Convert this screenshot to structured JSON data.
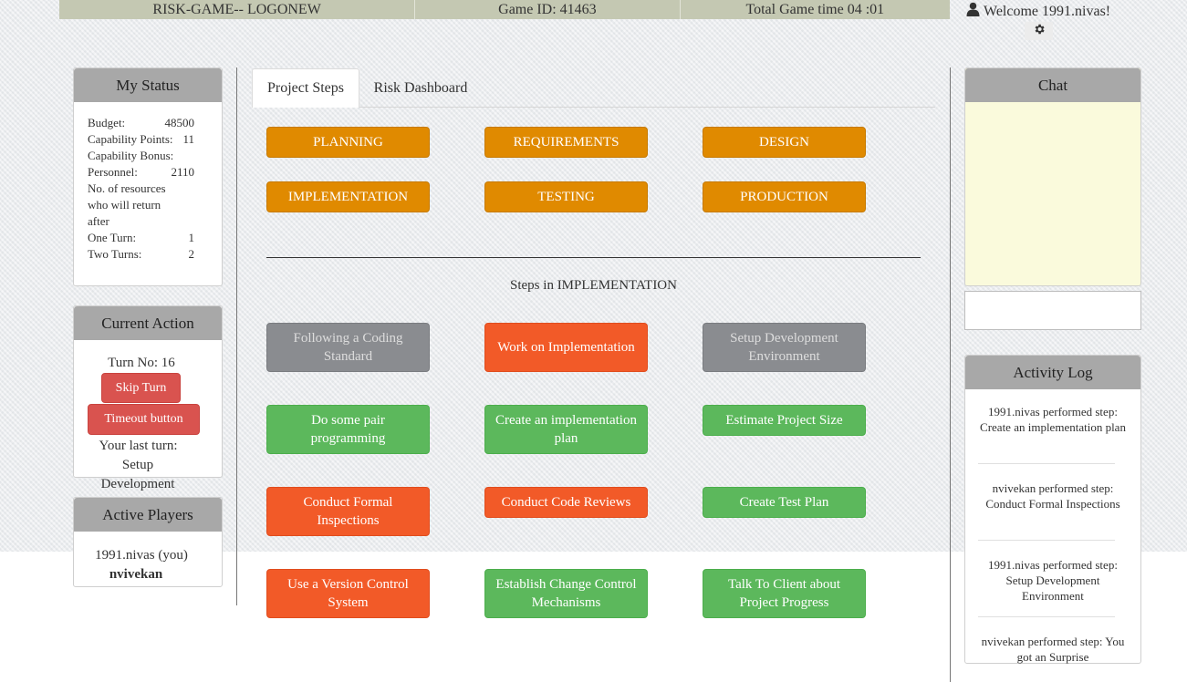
{
  "header": {
    "logo": "RISK-GAME-- LOGONEW",
    "game_id": "Game  ID: 41463",
    "total_time": "Total  Game  time  04 :01",
    "welcome": "Welcome    1991.nivas!"
  },
  "my_status": {
    "title": "My Status",
    "rows": [
      {
        "label": "Budget:",
        "value": "48500"
      },
      {
        "label": "Capability  Points:",
        "value": "11"
      },
      {
        "label": "Capability  Bonus:",
        "value": ""
      },
      {
        "label": "Personnel:",
        "value": "2110"
      },
      {
        "label": "No. of resources",
        "value": ""
      },
      {
        "label": "who will return",
        "value": ""
      },
      {
        "label": "after",
        "value": ""
      },
      {
        "label": "One  Turn:",
        "value": "1"
      },
      {
        "label": "Two  Turns:",
        "value": "2"
      }
    ]
  },
  "current_action": {
    "title": "Current  Action",
    "turn": "Turn  No: 16",
    "skip": "Skip  Turn",
    "timeout": "Timeout  button",
    "last_turn_label": "Your  last  turn:",
    "last_turn_value": "Setup Development Environment"
  },
  "active_players": {
    "title": "Active Players",
    "players": [
      "1991.nivas  (you)",
      "nvivekan"
    ]
  },
  "tabs": {
    "project_steps": "Project  Steps",
    "risk_dashboard": "Risk  Dashboard"
  },
  "phases": [
    "PLANNING",
    "REQUIREMENTS",
    "DESIGN",
    "IMPLEMENTATION",
    "TESTING",
    "PRODUCTION"
  ],
  "steps_title": "Steps  in  IMPLEMENTATION",
  "steps": [
    {
      "label": "Following  a Coding Standard",
      "state": "grey"
    },
    {
      "label": "Work  on Implementation",
      "state": "red"
    },
    {
      "label": "Setup  Development Environment",
      "state": "grey"
    },
    {
      "label": "Do  some  pair programming",
      "state": "green"
    },
    {
      "label": "Create  an implementation   plan",
      "state": "green"
    },
    {
      "label": "Estimate  Project  Size",
      "state": "green"
    },
    {
      "label": "Conduct  Formal Inspections",
      "state": "red"
    },
    {
      "label": "Conduct  Code Reviews",
      "state": "red"
    },
    {
      "label": "Create  Test Plan",
      "state": "green"
    },
    {
      "label": "Use  a Version  Control System",
      "state": "red"
    },
    {
      "label": "Establish  Change Control Mechanisms",
      "state": "green"
    },
    {
      "label": "Talk  To  Client  about Project Progress",
      "state": "green"
    }
  ],
  "chat": {
    "title": "Chat"
  },
  "activity_log": {
    "title": "Activity Log",
    "entries": [
      "1991.nivas  performed   step: Create  an  implementation plan",
      "nvivekan  performed   step: Conduct  Formal Inspections",
      "1991.nivas  performed   step: Setup Development Environment",
      "nvivekan  performed   step: You  got an  Surprise"
    ]
  },
  "colors": {
    "orange": "#e08a00",
    "red": "#f25a28",
    "green": "#5cb85c",
    "grey": "#8a8c90",
    "topbar": "#c4c8b2",
    "chat_bg": "#fafadc"
  },
  "icons": {
    "user": "user-icon",
    "settings": "gear-icon"
  }
}
